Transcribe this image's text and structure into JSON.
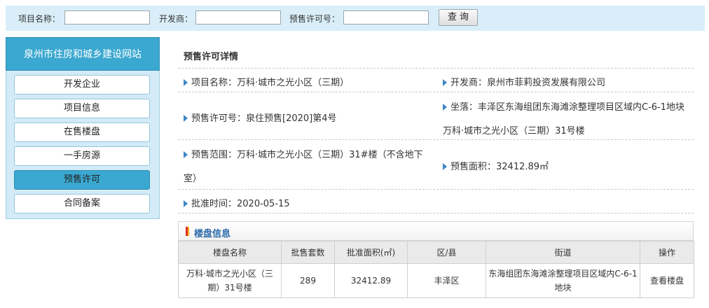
{
  "search": {
    "project_label": "项目名称：",
    "developer_label": "开发商：",
    "permit_label": "预售许可号：",
    "project_value": "",
    "developer_value": "",
    "permit_value": "",
    "button_label": "查询"
  },
  "sidebar": {
    "title": "泉州市住房和城乡建设网站",
    "items": [
      {
        "label": "开发企业"
      },
      {
        "label": "项目信息"
      },
      {
        "label": "在售楼盘"
      },
      {
        "label": "一手房源"
      },
      {
        "label": "预售许可"
      },
      {
        "label": "合同备案"
      }
    ],
    "active_color": "#3aa8d0"
  },
  "detail": {
    "title": "预售许可详情",
    "project_name": "项目名称：万科·城市之光小区（三期）",
    "developer": "开发商：泉州市菲莉投资发展有限公司",
    "permit_no": "预售许可号：泉住预售[2020]第4号",
    "location_line1": "坐落：丰泽区东海组团东海滩涂整理项目区域内C-6-1地块",
    "location_line2": "万科·城市之光小区（三期）31号楼",
    "scope_line1": "预售范围：万科·城市之光小区（三期）31#楼（不含地下",
    "scope_line2": "室）",
    "area": "预售面积：32412.89㎡",
    "approval_date": "批准时间：2020-05-15"
  },
  "buildings": {
    "section_title": "楼盘信息",
    "headers": [
      "楼盘名称",
      "批售套数",
      "批准面积(㎡)",
      "区/县",
      "街道",
      "操作"
    ],
    "rows": [
      {
        "name_line1": "万科·城市之光小区（三",
        "name_line2": "期）31号楼",
        "units": "289",
        "area": "32412.89",
        "district": "丰泽区",
        "street_line1": "东海组团东海滩涂整理项目区域内C-6-1",
        "street_line2": "地块",
        "action": "查看楼盘"
      }
    ]
  }
}
